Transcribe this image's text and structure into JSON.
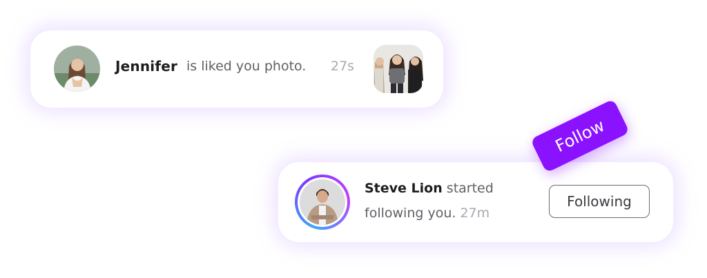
{
  "like_notification": {
    "user_name": "Jennifer",
    "action_text": "is liked you photo.",
    "time": "27s"
  },
  "follow_notification": {
    "user_name": "Steve Lion",
    "action_text_1": "started",
    "action_text_2": "following you.",
    "time": "27m",
    "button_label": "Following"
  },
  "follow_tag": {
    "label": "Follow"
  },
  "colors": {
    "accent": "#8a12ff",
    "card_shadow": "#ba8cff",
    "name_text": "#1d1d1f",
    "body_text": "#5f5f66",
    "time_text": "#a8a8b0"
  }
}
